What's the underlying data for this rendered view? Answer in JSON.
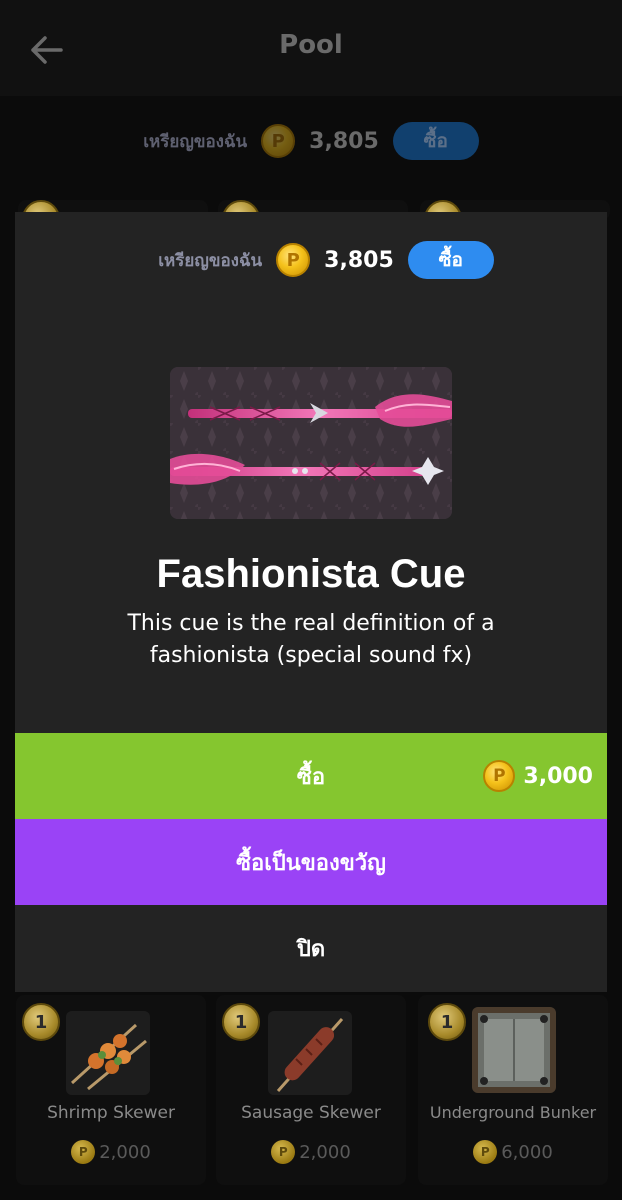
{
  "header": {
    "title": "Pool"
  },
  "coins": {
    "label": "เหรียญของฉัน",
    "coin_symbol": "P",
    "amount": "3,805",
    "buy_label": "ซื้อ"
  },
  "modal": {
    "coins": {
      "label": "เหรียญของฉัน",
      "coin_symbol": "P",
      "amount": "3,805",
      "buy_label": "ซื้อ"
    },
    "product": {
      "title": "Fashionista Cue",
      "description": "This cue is the real definition of a fashionista (special sound fx)"
    },
    "buy": {
      "label": "ซื้อ",
      "coin_symbol": "P",
      "price": "3,000"
    },
    "gift": {
      "label": "ซื้อเป็นของขวัญ"
    },
    "close": {
      "label": "ปิด"
    }
  },
  "items": [
    {
      "badge": "1",
      "name": "Shrimp Skewer",
      "coin_symbol": "P",
      "price": "2,000"
    },
    {
      "badge": "1",
      "name": "Sausage Skewer",
      "coin_symbol": "P",
      "price": "2,000"
    },
    {
      "badge": "1",
      "name": "Underground Bunker",
      "coin_symbol": "P",
      "price": "6,000"
    }
  ],
  "colors": {
    "buy_green": "#85c62f",
    "gift_purple": "#9a43f6",
    "coin_buy_blue": "#2e8cf0",
    "modal_bg": "#232323"
  }
}
